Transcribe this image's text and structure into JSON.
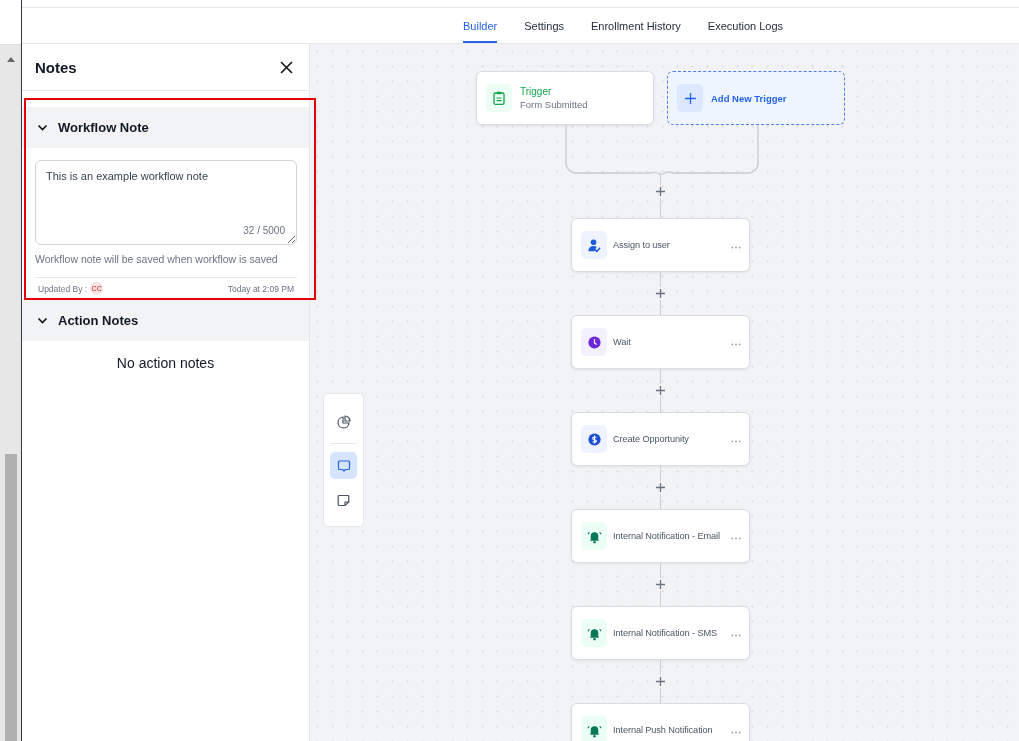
{
  "tabs": [
    {
      "label": "Builder",
      "selected": true
    },
    {
      "label": "Settings",
      "selected": false
    },
    {
      "label": "Enrollment History",
      "selected": false
    },
    {
      "label": "Execution Logs",
      "selected": false
    }
  ],
  "notes_panel": {
    "title": "Notes",
    "workflow_note": {
      "title": "Workflow Note",
      "expanded": true,
      "highlighted": true,
      "value": "This is an example workflow note",
      "counter": "32 / 5000",
      "hint": "Workflow note will be saved when workflow is saved",
      "updated_by_label": "Updated By :",
      "updated_by_initials": "CC",
      "updated_at": "Today at 2:09 PM"
    },
    "action_notes": {
      "title": "Action Notes",
      "expanded": true,
      "empty_text": "No action notes"
    }
  },
  "side_toolbar": [
    {
      "kind": "stats",
      "selected": false
    },
    {
      "kind": "notes",
      "selected": true
    },
    {
      "kind": "sticky",
      "selected": false
    }
  ],
  "triggers": [
    {
      "kind": "trigger",
      "title": "Trigger",
      "subtitle": "Form Submitted"
    },
    {
      "kind": "add",
      "label": "Add New Trigger"
    }
  ],
  "actions": [
    {
      "kind": "assign",
      "label": "Assign to user"
    },
    {
      "kind": "wait",
      "label": "Wait"
    },
    {
      "kind": "opportunity",
      "label": "Create Opportunity"
    },
    {
      "kind": "notification",
      "label": "Internal Notification - Email"
    },
    {
      "kind": "notification",
      "label": "Internal Notification - SMS"
    },
    {
      "kind": "notification",
      "label": "Internal Push Notification"
    }
  ]
}
